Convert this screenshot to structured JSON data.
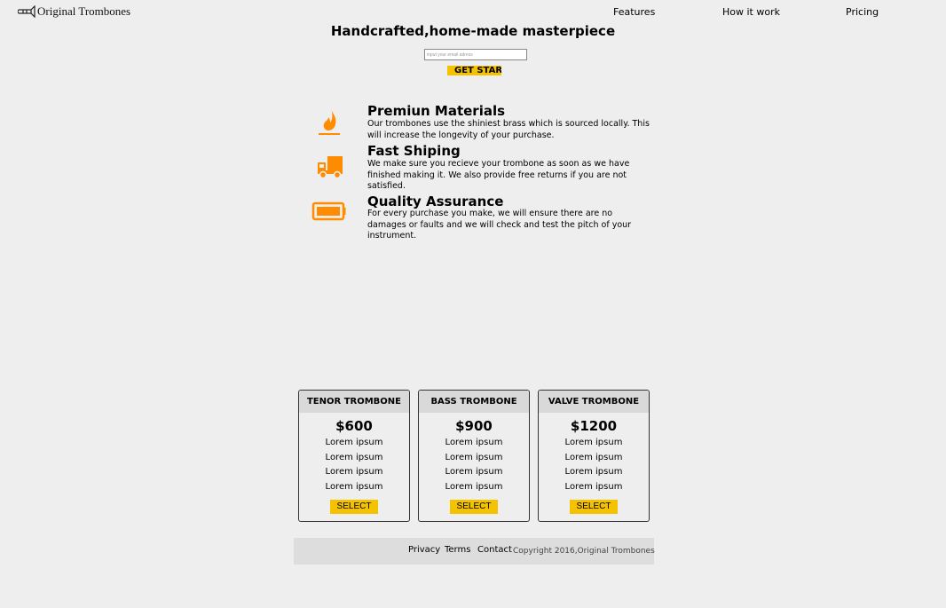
{
  "header": {
    "logo_text": "Original Trombones",
    "nav": [
      "Features",
      "How it work",
      "Pricing"
    ]
  },
  "hero": {
    "title": "Handcrafted,home-made masterpiece",
    "email_placeholder": "input your email adress",
    "cta_label": "GET STARTED"
  },
  "features": [
    {
      "icon": "fire-icon",
      "title": "Premiun Materials",
      "text": "Our trombones use the shiniest brass which is sourced locally. This will increase the longevity of your purchase."
    },
    {
      "icon": "truck-icon",
      "title": "Fast Shiping",
      "text": "We make sure you recieve your trombone as soon as we have finished making it. We also provide free returns if you are not satisfied."
    },
    {
      "icon": "battery-icon",
      "title": "Quality Assurance",
      "text": "For every purchase you make, we will ensure there are no damages or faults and we will check and test the pitch of your instrument."
    }
  ],
  "pricing": [
    {
      "name": "TENOR TROMBONE",
      "price": "$600",
      "lines": [
        "Lorem ipsum",
        "Lorem ipsum",
        "Lorem ipsum",
        "Lorem ipsum"
      ],
      "button": "SELECT"
    },
    {
      "name": "BASS TROMBONE",
      "price": "$900",
      "lines": [
        "Lorem ipsum",
        "Lorem ipsum",
        "Lorem ipsum",
        "Lorem ipsum"
      ],
      "button": "SELECT"
    },
    {
      "name": "VALVE TROMBONE",
      "price": "$1200",
      "lines": [
        "Lorem ipsum",
        "Lorem ipsum",
        "Lorem ipsum",
        "Lorem ipsum"
      ],
      "button": "SELECT"
    }
  ],
  "footer": {
    "links": [
      "Privacy",
      "Terms",
      "Contact"
    ],
    "copyright": "Copyright 2016,Original Trombones"
  },
  "colors": {
    "accent": "#f5c200",
    "icon": "#ff8c00",
    "background": "#eeeeee"
  }
}
